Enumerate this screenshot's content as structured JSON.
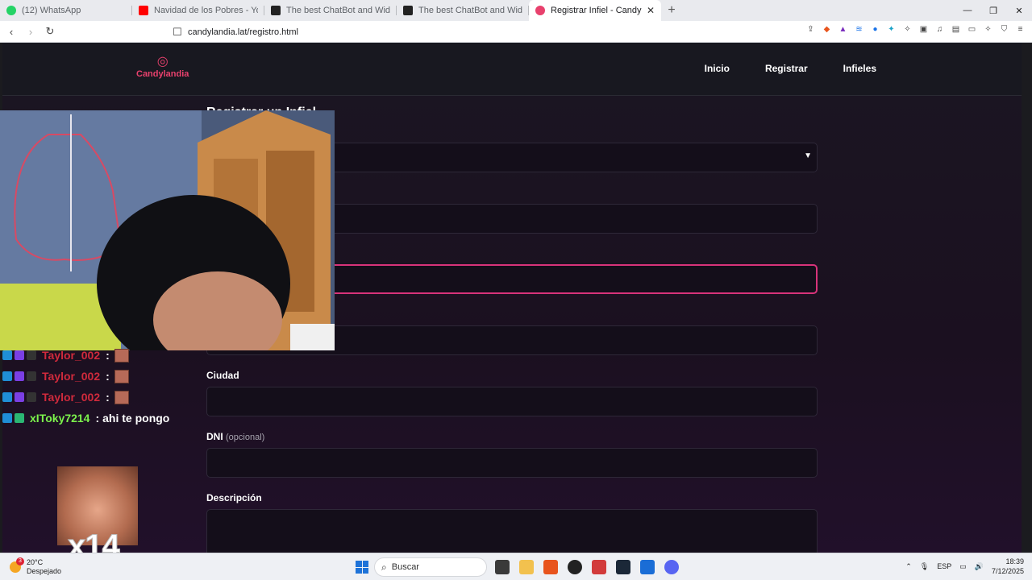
{
  "browser": {
    "tabs": [
      {
        "title": "(12) WhatsApp",
        "color": "#25d366",
        "active": false
      },
      {
        "title": "Navidad de los Pobres - YouTube",
        "color": "#ff0000",
        "active": false
      },
      {
        "title": "The best ChatBot and Widgets for Ki",
        "color": "#222222",
        "active": false
      },
      {
        "title": "The best ChatBot and Widgets fo",
        "color": "#222222",
        "active": false
      },
      {
        "title": "Registrar Infiel - Candylandia",
        "color": "#e8416d",
        "active": true
      }
    ],
    "new_tab_label": "+",
    "url": "candylandia.lat/registro.html",
    "window_controls": {
      "minimize": "—",
      "restore": "❐",
      "close": "✕"
    }
  },
  "site": {
    "logo_text": "Candylandia",
    "nav": [
      "Inicio",
      "Registrar",
      "Infieles"
    ],
    "form_title": "Registrar un Infiel",
    "labels": {
      "ciudad": "Ciudad",
      "dni": "DNI",
      "dni_optional": "(opcional)",
      "descripcion": "Descripción"
    }
  },
  "overlay": {
    "chat": [
      {
        "user": "Taylor_002",
        "color": "#d02a3c",
        "separator": ":",
        "message": ""
      },
      {
        "user": "Taylor_002",
        "color": "#d02a3c",
        "separator": ":",
        "message": ""
      },
      {
        "user": "Taylor_002",
        "color": "#d02a3c",
        "separator": ":",
        "message": ""
      },
      {
        "user": "xIToky7214",
        "color": "#7cf34c",
        "separator": ":",
        "message": "ahi te pongo"
      }
    ],
    "emote_count": "x14"
  },
  "taskbar": {
    "weather_temp": "20°C",
    "weather_desc": "Despejado",
    "search_placeholder": "Buscar",
    "lang": "ESP",
    "time": "18:39",
    "date": "7/12/2025"
  },
  "colors": {
    "accent": "#e8416d",
    "focus_border": "#d8337a"
  }
}
